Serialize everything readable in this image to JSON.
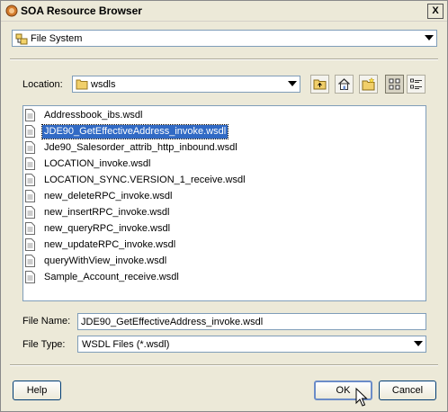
{
  "window": {
    "title": "SOA Resource Browser",
    "close_label": "X"
  },
  "resource_type": {
    "value": "File System",
    "icon": "file-system-icon"
  },
  "location": {
    "label": "Location:",
    "value": "wsdls",
    "icon": "folder-icon"
  },
  "toolbar": {
    "buttons": [
      {
        "name": "up-one-level-button",
        "icon": "folder-up-icon"
      },
      {
        "name": "home-button",
        "icon": "home-icon"
      },
      {
        "name": "new-folder-button",
        "icon": "new-folder-icon"
      },
      {
        "name": "list-view-button",
        "icon": "list-view-icon"
      },
      {
        "name": "details-view-button",
        "icon": "details-view-icon"
      }
    ]
  },
  "files": [
    "Addressbook_ibs.wsdl",
    "JDE90_GetEffectiveAddress_invoke.wsdl",
    "Jde90_Salesorder_attrib_http_inbound.wsdl",
    "LOCATION_invoke.wsdl",
    "LOCATION_SYNC.VERSION_1_receive.wsdl",
    "new_deleteRPC_invoke.wsdl",
    "new_insertRPC_invoke.wsdl",
    "new_queryRPC_invoke.wsdl",
    "new_updateRPC_invoke.wsdl",
    "queryWithView_invoke.wsdl",
    "Sample_Account_receive.wsdl"
  ],
  "selected_file": "JDE90_GetEffectiveAddress_invoke.wsdl",
  "file_name": {
    "label": "File Name:",
    "value": "JDE90_GetEffectiveAddress_invoke.wsdl"
  },
  "file_type": {
    "label": "File Type:",
    "value": "WSDL Files (*.wsdl)"
  },
  "buttons": {
    "help": "Help",
    "ok": "OK",
    "cancel": "Cancel"
  }
}
